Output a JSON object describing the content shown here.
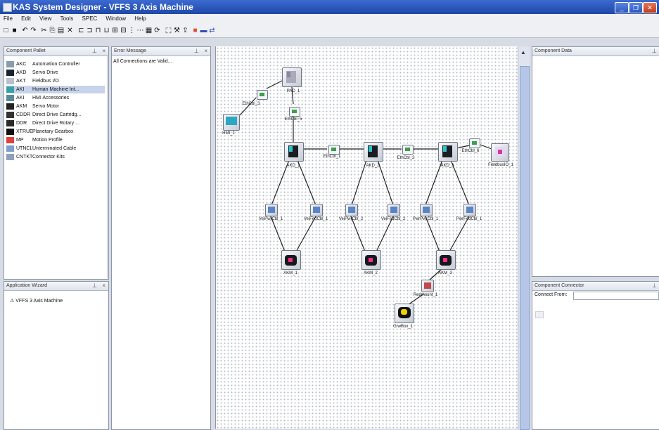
{
  "window": {
    "title": "KAS System Designer - VFFS 3 Axis Machine",
    "controls": [
      "_",
      "❐",
      "✕"
    ]
  },
  "menu": [
    "File",
    "Edit",
    "View",
    "Tools",
    "SPEC",
    "Window",
    "Help"
  ],
  "toolbar_icons": [
    "new-icon",
    "save-icon",
    "undo-icon",
    "redo-icon",
    "cut-icon",
    "copy-icon",
    "paste-icon",
    "delete-icon",
    "align-left-icon",
    "align-center-icon",
    "align-right-icon",
    "align-top-icon",
    "align-middle-icon",
    "align-bottom-icon",
    "distribute-h-icon",
    "distribute-v-icon",
    "grid-icon",
    "refresh-icon",
    "select-icon",
    "tools-icon",
    "export-icon",
    "motor-icon",
    "connector-icon",
    "link-icon"
  ],
  "component_palette": {
    "title": "Component Pallet",
    "items": [
      {
        "code": "AKC",
        "label": "Automation Controller",
        "color": "#8a9bb0"
      },
      {
        "code": "AKD",
        "label": "Servo Drive",
        "color": "#1b2330"
      },
      {
        "code": "AKT",
        "label": "Fieldbus I/O",
        "color": "#b8c0cc"
      },
      {
        "code": "AKI",
        "label": "Human Machine Int...",
        "color": "#3aa0a8",
        "selected": true
      },
      {
        "code": "AKI",
        "label": "HMI Accessories",
        "color": "#5a8a9a"
      },
      {
        "code": "AKM",
        "label": "Servo Motor",
        "color": "#222"
      },
      {
        "code": "CDDR",
        "label": "Direct Drive Cartridg...",
        "color": "#333"
      },
      {
        "code": "DDR",
        "label": "Direct Drive Rotary ...",
        "color": "#2a2a2a"
      },
      {
        "code": "XTRUE",
        "label": "Planetary Gearbox",
        "color": "#111"
      },
      {
        "code": "MP",
        "label": "Motion Profile",
        "color": "#e04040"
      },
      {
        "code": "UTNCL",
        "label": "Unterminated Cable",
        "color": "#7aa0d0"
      },
      {
        "code": "CNTKT",
        "label": "Connector Kits",
        "color": "#90a0b8"
      }
    ]
  },
  "error_panel": {
    "title": "Error Message",
    "message": "All Connections are Valid..."
  },
  "app_wizard": {
    "title": "Application Wizard",
    "item": "VFFS 3 Axis Machine"
  },
  "component_data": {
    "title": "Component Data"
  },
  "component_connector": {
    "title": "Component Connector",
    "connect_from_label": "Connect From:"
  },
  "diagram": {
    "nodes": [
      {
        "id": "PAC_1",
        "label": "PAC_1",
        "kind": "plc"
      },
      {
        "id": "EthCbl_3",
        "label": "EthCbl_3",
        "kind": "conn"
      },
      {
        "id": "EthCbl_5",
        "label": "EthCbl_5",
        "kind": "conn"
      },
      {
        "id": "HMI_1",
        "label": "HMI_1",
        "kind": "hmi"
      },
      {
        "id": "AKD_1",
        "label": "AKD_1",
        "kind": "drive"
      },
      {
        "id": "EthCbl_1",
        "label": "EthCbl_1",
        "kind": "conn"
      },
      {
        "id": "AKD_2",
        "label": "AKD_2",
        "kind": "drive"
      },
      {
        "id": "EthCbl_2",
        "label": "EthCbl_2",
        "kind": "conn"
      },
      {
        "id": "AKD_3",
        "label": "AKD_3",
        "kind": "drive"
      },
      {
        "id": "EthCbl_6",
        "label": "EthCbl_6",
        "kind": "conn"
      },
      {
        "id": "FieldbusIO_1",
        "label": "FieldbusIO_1",
        "kind": "io"
      },
      {
        "id": "VeiPwrCbl_1",
        "label": "VeiPwrCbl_1",
        "kind": "small"
      },
      {
        "id": "VeiFedCbl_1",
        "label": "VeiFedCbl_1",
        "kind": "small"
      },
      {
        "id": "VeiPwrCbl_2",
        "label": "VeiPwrCbl_2",
        "kind": "small"
      },
      {
        "id": "VeiFedCbl_2",
        "label": "VeiFedCbl_2",
        "kind": "small"
      },
      {
        "id": "PwrPwrCbl_1",
        "label": "PwrPwrCbl_1",
        "kind": "small"
      },
      {
        "id": "PwrFedCbl_1",
        "label": "PwrFedCbl_1",
        "kind": "small"
      },
      {
        "id": "AKM_1",
        "label": "AKM_1",
        "kind": "motor"
      },
      {
        "id": "AKM_2",
        "label": "AKM_2",
        "kind": "motor"
      },
      {
        "id": "AKM_3",
        "label": "AKM_3",
        "kind": "motor"
      },
      {
        "id": "Redmount_1",
        "label": "Redmount_1",
        "kind": "small"
      },
      {
        "id": "GrwBox_1",
        "label": "GrwBox_1",
        "kind": "gear"
      }
    ]
  }
}
